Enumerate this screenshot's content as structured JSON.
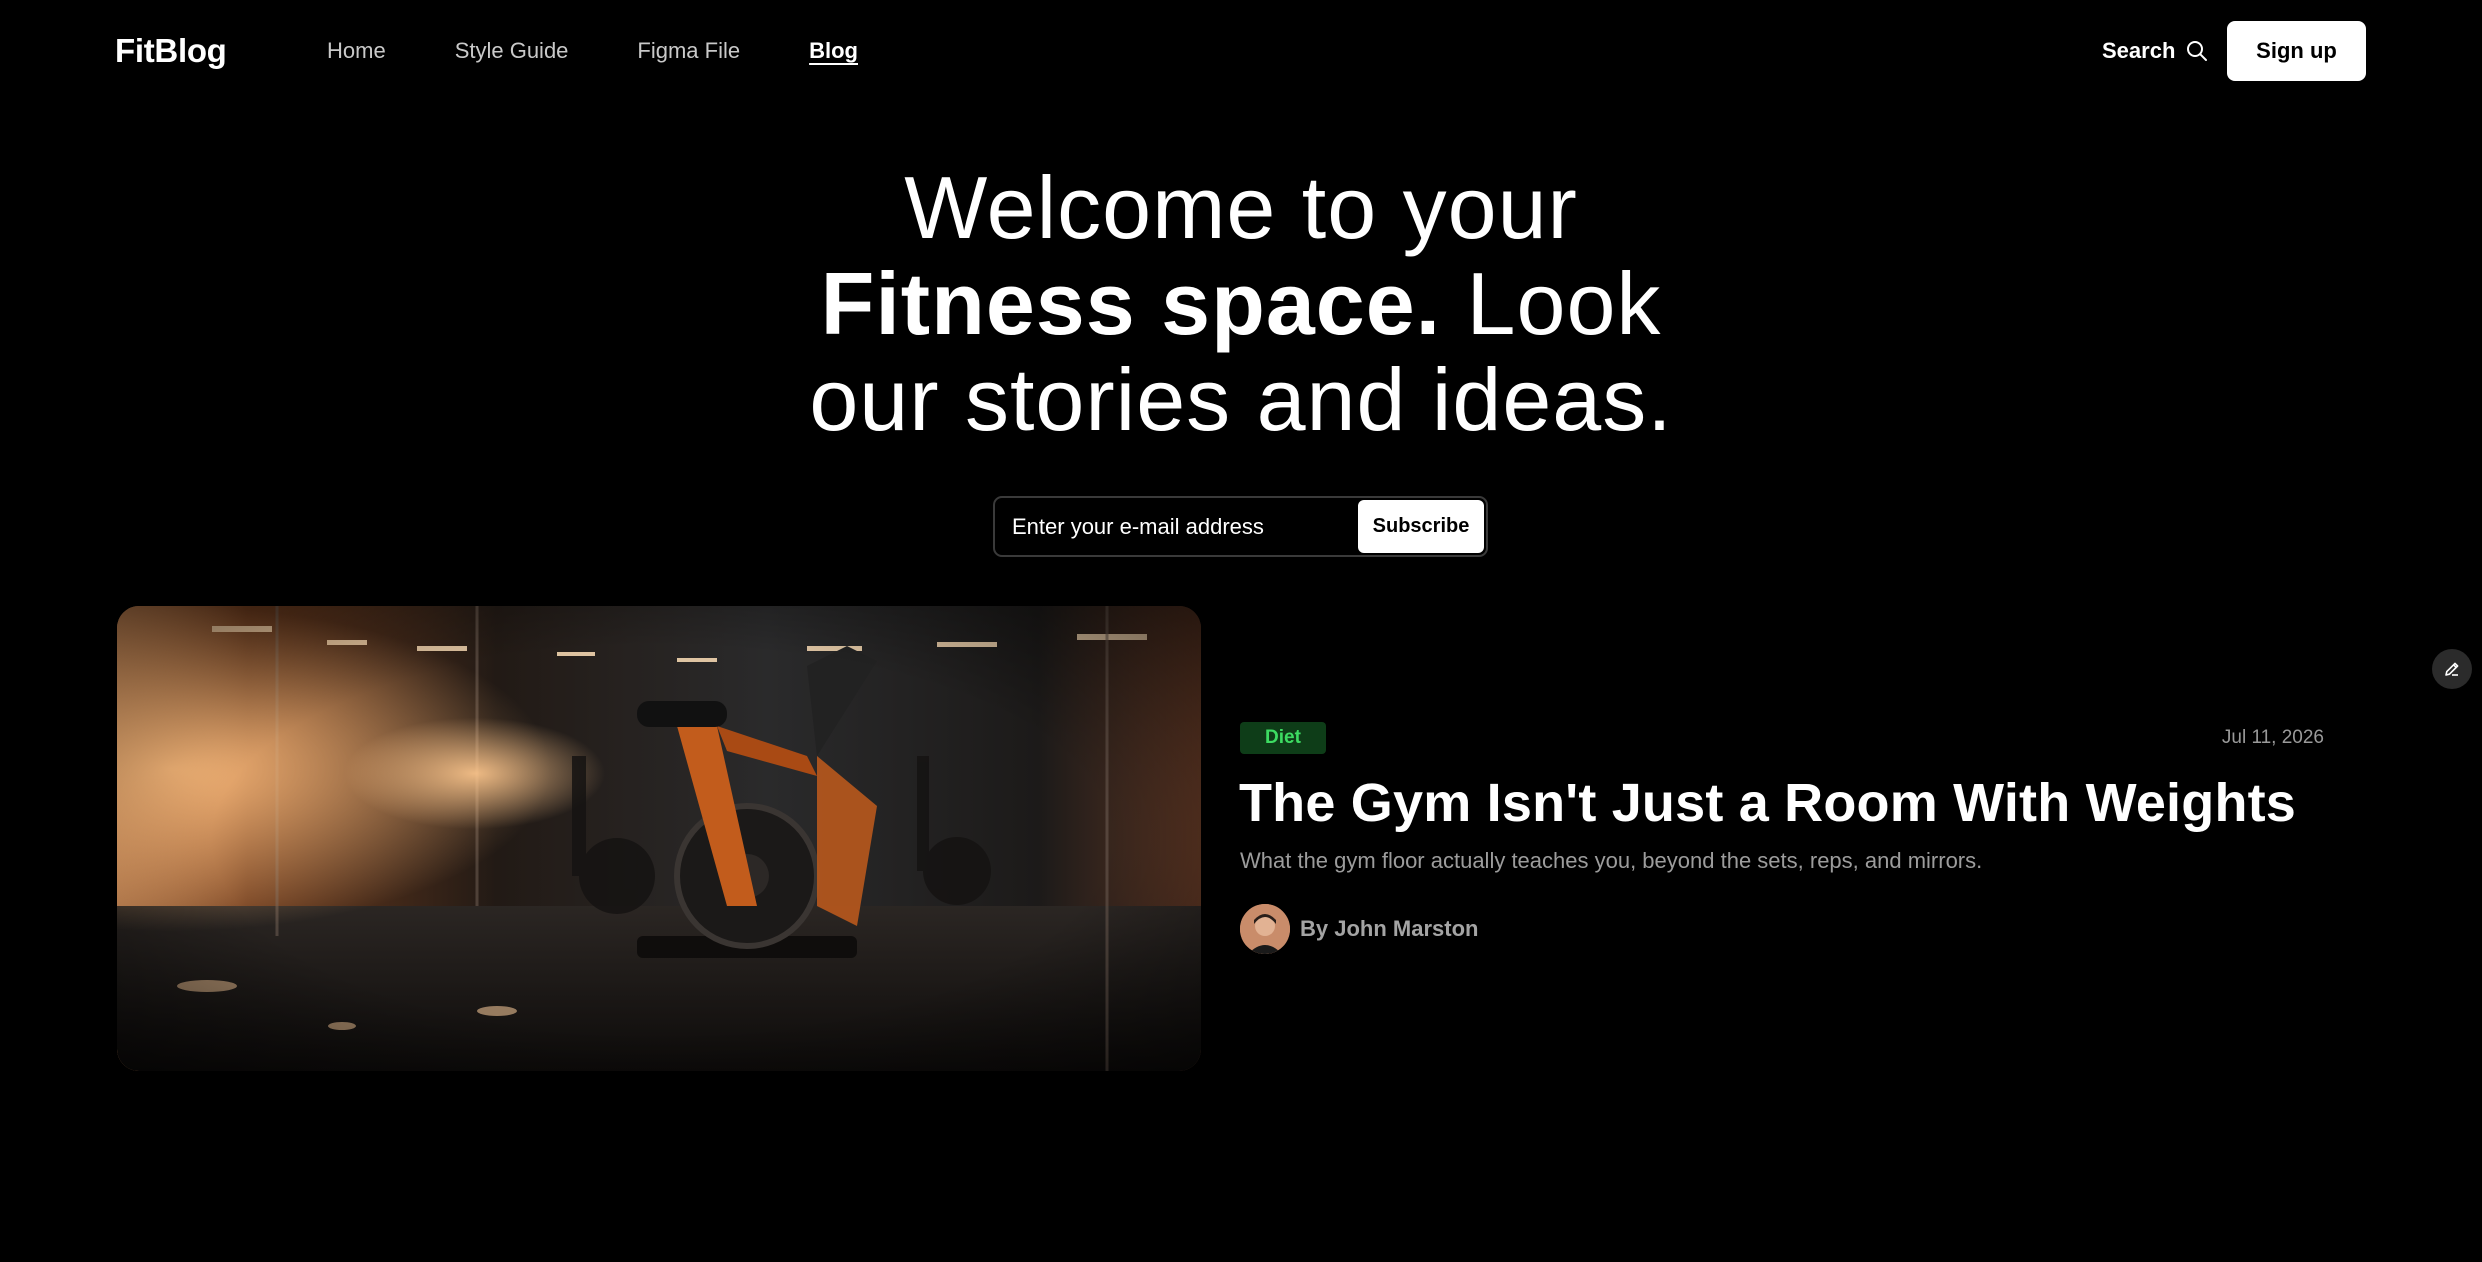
{
  "brand": {
    "name": "FitBlog"
  },
  "nav": {
    "links": [
      {
        "label": "Home",
        "active": false
      },
      {
        "label": "Style Guide",
        "active": false
      },
      {
        "label": "Figma File",
        "active": false
      },
      {
        "label": "Blog",
        "active": true
      }
    ],
    "search_label": "Search",
    "search_icon": "search-icon",
    "signup_label": "Sign up"
  },
  "hero": {
    "line1": "Welcome to your",
    "line2_bold": "Fitness space.",
    "line2_rest": " Look",
    "line3": "our stories and ideas."
  },
  "subscribe": {
    "placeholder": "Enter your e-mail address",
    "button_label": "Subscribe"
  },
  "featured_post": {
    "image_icon": "gym-bikes-photo",
    "tag": "Diet",
    "date": "Jul 11, 2026",
    "title": "The Gym Isn't Just a Room With Weights",
    "excerpt": "What the gym floor actually teaches you, beyond the sets, reps, and mirrors.",
    "author": "By John Marston"
  },
  "edit_button_icon": "pencil-icon",
  "colors": {
    "background": "#000000",
    "text": "#ffffff",
    "muted_text": "#9c9c9c",
    "tag_bg": "#0e3d18",
    "tag_text": "#3ddc62",
    "button_bg": "#ffffff",
    "button_text": "#000000"
  }
}
